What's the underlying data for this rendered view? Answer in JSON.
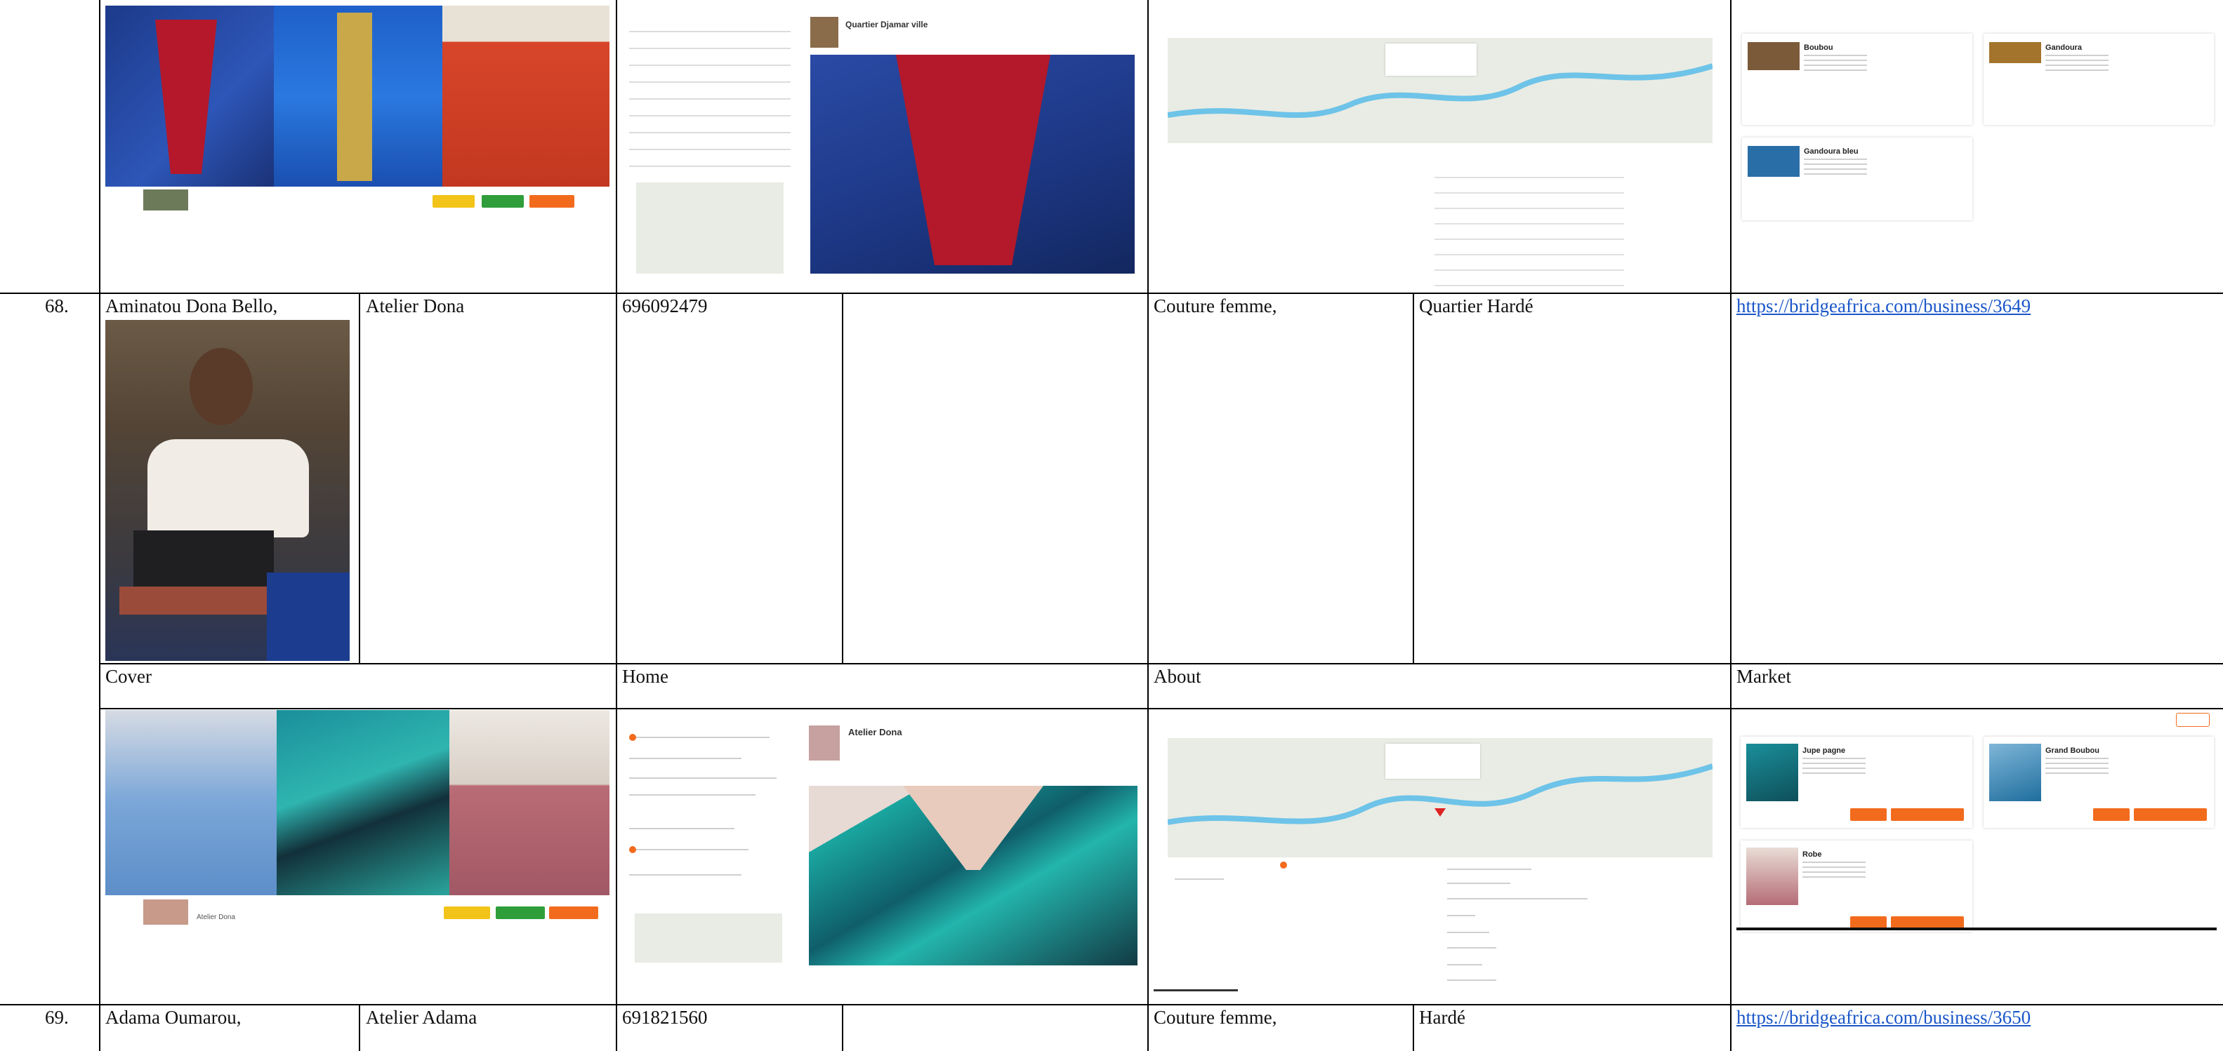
{
  "rows": [
    {
      "number": "68.",
      "owner": "Aminatou Dona Bello,",
      "business": "Atelier Dona",
      "phone": "696092479",
      "category": "Couture femme,",
      "location": "Quartier Hardé",
      "link": "https://bridgeafrica.com/business/3649",
      "sections": {
        "cover": "Cover",
        "home": "Home",
        "about": "About",
        "market": "Market"
      },
      "cover_caption": "Atelier Dona",
      "home_post_title": "Atelier Dona",
      "market_items": [
        "Jupe pagne",
        "Grand Boubou",
        "Robe"
      ]
    },
    {
      "number": "69.",
      "owner": "Adama Oumarou,",
      "business": "Atelier Adama",
      "phone": "691821560",
      "category": "Couture femme,",
      "location": "Hardé",
      "link": "https://bridgeafrica.com/business/3650"
    }
  ],
  "previous": {
    "home_post_title": "Quartier Djamar ville",
    "market_items": [
      "Boubou",
      "Gandoura",
      "Gandoura bleu"
    ]
  },
  "colors": {
    "accent": "#f26b1d",
    "green": "#2f9e3a",
    "yellow": "#f2c318",
    "link": "#1a56c9",
    "river": "#6ec3e8"
  }
}
